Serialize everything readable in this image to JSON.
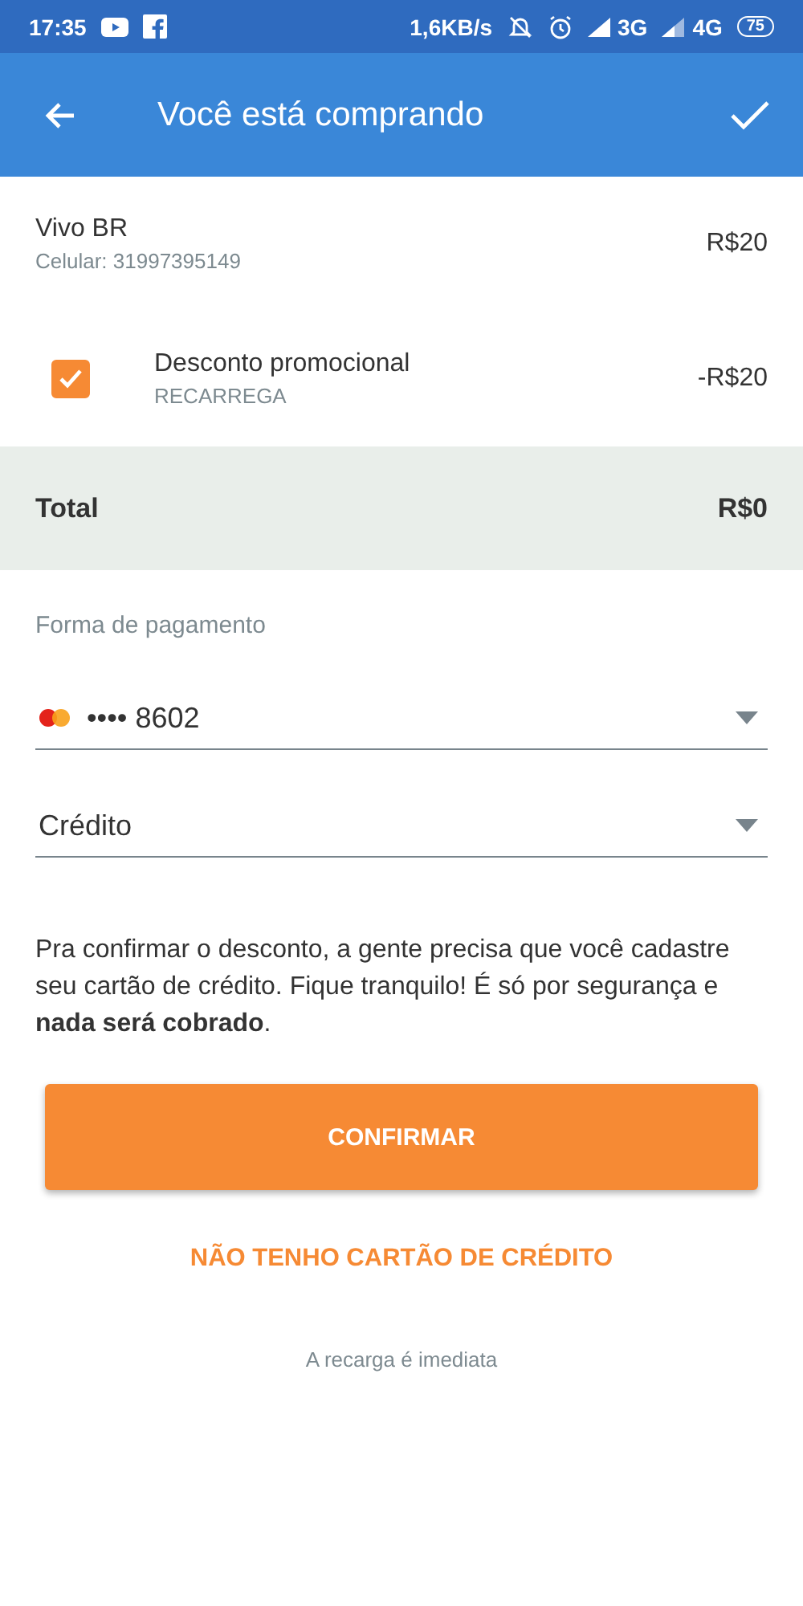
{
  "status_bar": {
    "time": "17:35",
    "speed": "1,6KB/s",
    "network_1": "3G",
    "network_2": "4G",
    "battery": "75"
  },
  "app_bar": {
    "title": "Você está comprando"
  },
  "items": [
    {
      "kind": "product",
      "name": "Vivo BR",
      "detail": "Celular: 31997395149",
      "price": "R$20"
    },
    {
      "kind": "discount",
      "name": "Desconto promocional",
      "detail": "RECARREGA",
      "price": "-R$20",
      "checked": true
    }
  ],
  "total": {
    "label": "Total",
    "value": "R$0"
  },
  "payment": {
    "heading": "Forma de pagamento",
    "card": "•••• 8602",
    "type": "Crédito"
  },
  "notice": "Pra confirmar o desconto, a gente precisa que você cadastre seu cartão de crédito. Fique tranquilo! É só por segurança e **nada será cobrado**.",
  "confirm_button": "CONFIRMAR",
  "no_card_link": "NÃO TENHO CARTÃO DE CRÉDITO",
  "footer": "A recarga é imediata"
}
